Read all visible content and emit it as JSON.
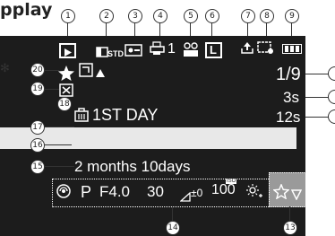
{
  "header": {
    "crop_text": "pplay"
  },
  "screen": {
    "std_label": "STD",
    "print_count": "1",
    "size_label": "L",
    "image_counter": "1/9",
    "value_3s": "3s",
    "value_12s": "12s",
    "travel_day": "1ST DAY",
    "elapsed": "2 months 10days",
    "mode": "P",
    "aperture": "F4.0",
    "shutter": "30",
    "exposure": "±0",
    "iso": "100",
    "iso_label": "ISO"
  },
  "callouts": [
    "1",
    "2",
    "3",
    "4",
    "5",
    "6",
    "7",
    "8",
    "9",
    "13",
    "14",
    "15",
    "16",
    "17",
    "18",
    "19",
    "20"
  ]
}
